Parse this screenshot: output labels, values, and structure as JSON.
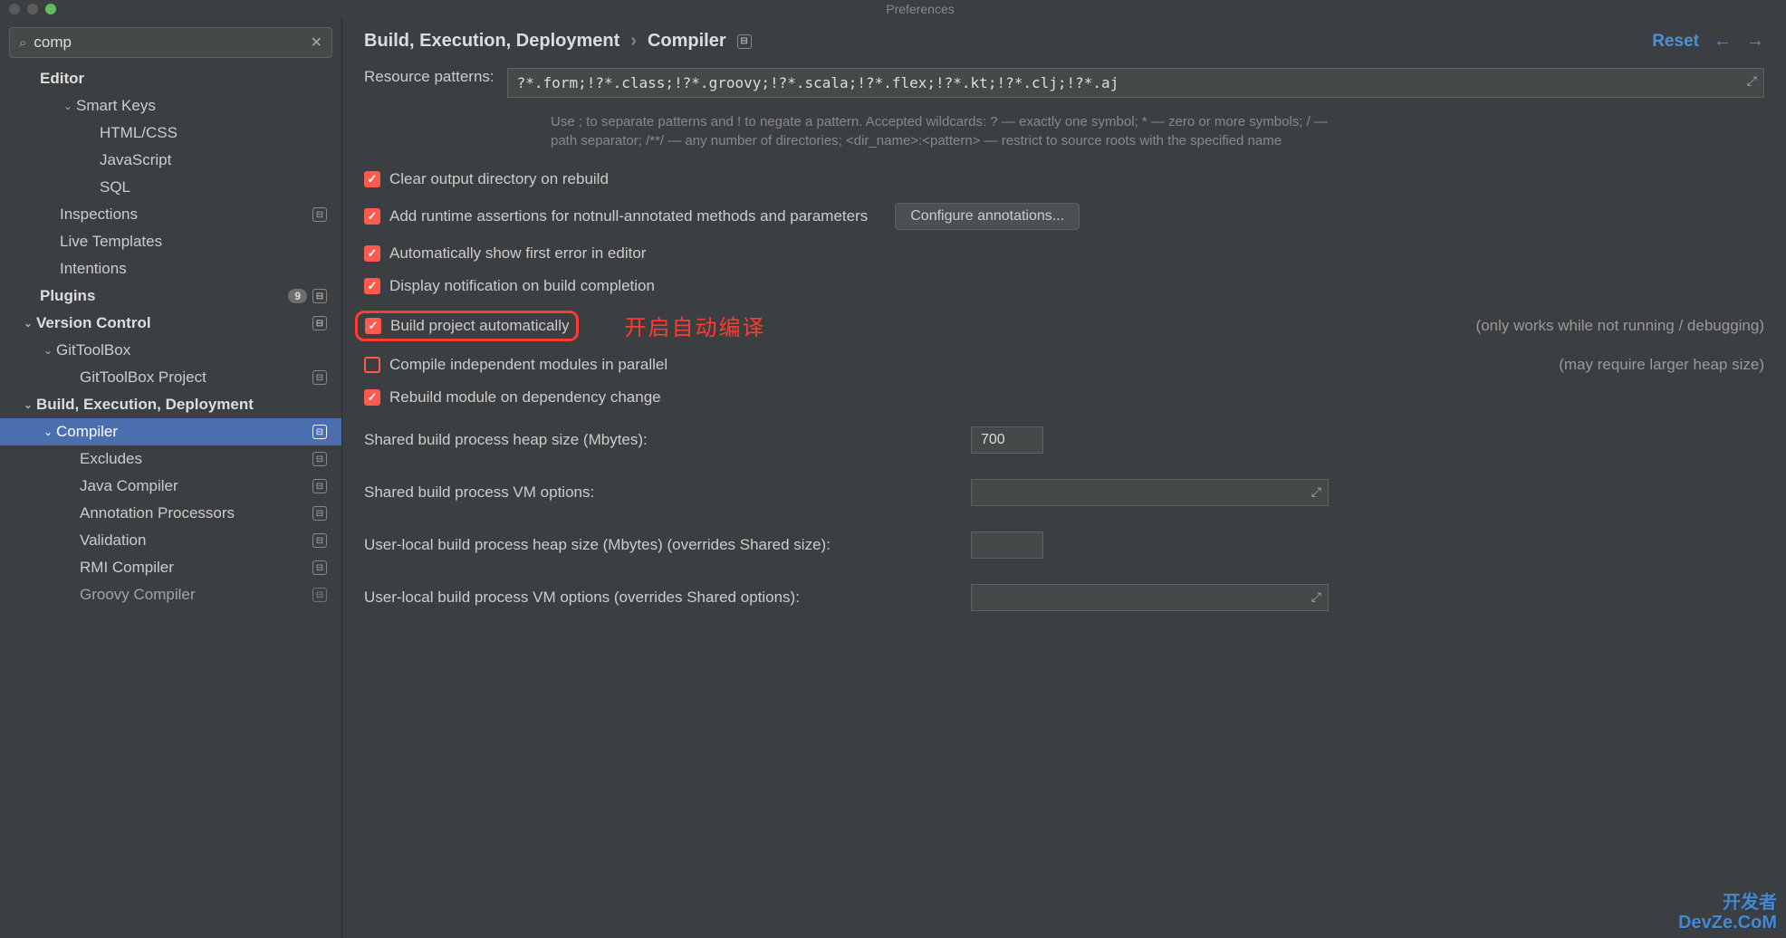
{
  "window": {
    "title": "Preferences"
  },
  "search": {
    "value": "comp"
  },
  "tree": {
    "editor": "Editor",
    "smart_keys": "Smart Keys",
    "html_css": "HTML/CSS",
    "javascript": "JavaScript",
    "sql": "SQL",
    "inspections": "Inspections",
    "live_templates": "Live Templates",
    "intentions": "Intentions",
    "plugins": "Plugins",
    "plugins_count": "9",
    "version_control": "Version Control",
    "gittoolbox": "GitToolBox",
    "gittoolbox_project": "GitToolBox Project",
    "bed": "Build, Execution, Deployment",
    "compiler": "Compiler",
    "excludes": "Excludes",
    "java_compiler": "Java Compiler",
    "annotation_processors": "Annotation Processors",
    "validation": "Validation",
    "rmi_compiler": "RMI Compiler",
    "groovy_compiler": "Groovy Compiler"
  },
  "header": {
    "crumb1": "Build, Execution, Deployment",
    "crumb2": "Compiler",
    "reset": "Reset"
  },
  "form": {
    "resource_patterns_label": "Resource patterns:",
    "resource_patterns_value": "?*.form;!?*.class;!?*.groovy;!?*.scala;!?*.flex;!?*.kt;!?*.clj;!?*.aj",
    "help_text": "Use ; to separate patterns and ! to negate a pattern. Accepted wildcards: ? — exactly one symbol; * — zero or more symbols; / — path separator; /**/ — any number of directories; <dir_name>:<pattern> — restrict to source roots with the specified name",
    "chk_clear": "Clear output directory on rebuild",
    "chk_assert": "Add runtime assertions for notnull-annotated methods and parameters",
    "btn_configure": "Configure annotations...",
    "chk_first_error": "Automatically show first error in editor",
    "chk_notify": "Display notification on build completion",
    "chk_auto_build": "Build project automatically",
    "hint_auto_build": "(only works while not running / debugging)",
    "annotation_text": "开启自动编译",
    "chk_parallel": "Compile independent modules in parallel",
    "hint_parallel": "(may require larger heap size)",
    "chk_rebuild_dep": "Rebuild module on dependency change",
    "shared_heap_label": "Shared build process heap size (Mbytes):",
    "shared_heap_value": "700",
    "shared_vm_label": "Shared build process VM options:",
    "user_heap_label": "User-local build process heap size (Mbytes) (overrides Shared size):",
    "user_vm_label": "User-local build process VM options (overrides Shared options):"
  },
  "watermark": {
    "line1": "开发者",
    "line2": "DevZe.CoM"
  }
}
